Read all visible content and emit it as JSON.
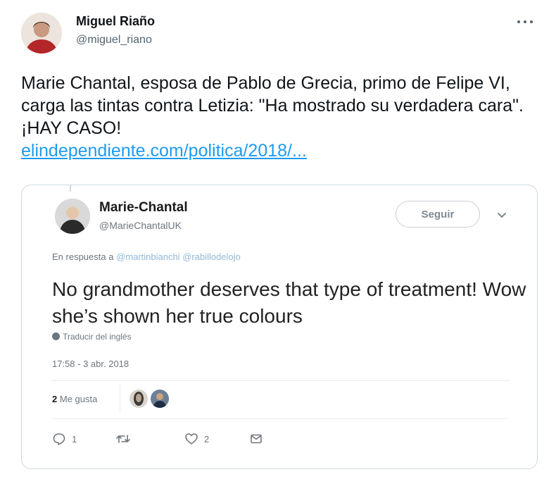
{
  "tweet": {
    "author": {
      "name": "Miguel Riaño",
      "handle": "@miguel_riano"
    },
    "more_icon": "more-horizontal-icon",
    "text": "Marie Chantal, esposa de Pablo de Grecia, primo de Felipe VI, carga las tintas contra Letizia: \"Ha mostrado su verdadera cara\". ¡HAY CASO!",
    "link": "elindependiente.com/politica/2018/..."
  },
  "quoted": {
    "author": {
      "name": "Marie-Chantal",
      "handle": "@MarieChantalUK"
    },
    "follow_label": "Seguir",
    "reply_prefix": "En respuesta a",
    "reply_mentions": "@martinbianchi @rabillodelojo",
    "text": "No grandmother deserves that type of treatment! Wow she’s shown her true colours",
    "translate_label": "Traducir del inglés",
    "timestamp": "17:58 - 3 abr. 2018",
    "likes_count": "2",
    "likes_label": "Me gusta",
    "actions": {
      "reply_count": "1",
      "retweet_count": "",
      "like_count": "2"
    }
  },
  "colors": {
    "link": "#1d9bf0",
    "text": "#0f1419",
    "muted": "#536471",
    "border": "#cfd9de"
  }
}
